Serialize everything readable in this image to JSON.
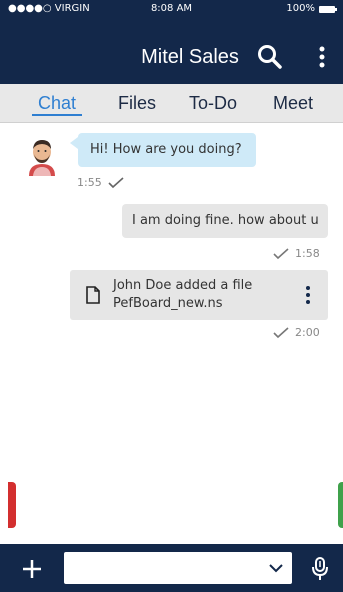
{
  "status_bar": {
    "carrier": "●●●●○ VIRGIN",
    "time": "8:08 AM",
    "battery": "100%"
  },
  "header": {
    "title": "Mitel Sales",
    "search_icon": "search-icon",
    "menu_icon": "more-vertical-icon"
  },
  "tabs": [
    {
      "label": "Chat",
      "active": true
    },
    {
      "label": "Files",
      "active": false
    },
    {
      "label": "To-Do",
      "active": false
    },
    {
      "label": "Meet",
      "active": false
    }
  ],
  "messages": [
    {
      "type": "incoming",
      "text": "Hi! How are you doing?",
      "time": "1:55"
    },
    {
      "type": "outgoing",
      "text": "I am doing fine. how about u",
      "time": "1:58"
    },
    {
      "type": "file",
      "line1": "John Doe added a file",
      "line2": "PefBoard_new.ns",
      "time": "2:00"
    }
  ],
  "composer": {
    "value": "",
    "placeholder": ""
  },
  "colors": {
    "header_bg": "#13284a",
    "accent_blue": "#2f7fd1",
    "incoming_bubble": "#cfeaf8",
    "outgoing_bubble": "#e6e6e6",
    "red_accent": "#d32f2f",
    "green_accent": "#3fa14b"
  }
}
